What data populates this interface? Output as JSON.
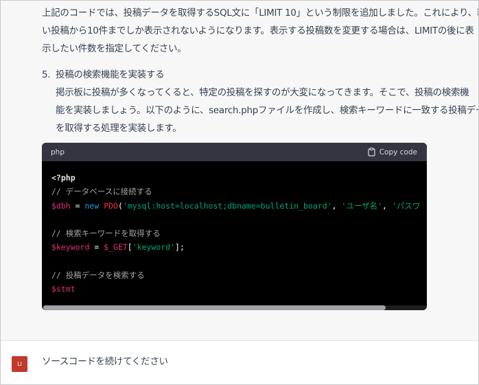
{
  "message": {
    "paragraph_lines": [
      "上記のコードでは、投稿データを取得するSQL文に「LIMIT 10」という制限を追加しました。これにより、新し",
      "い投稿から10件までしか表示されないようになります。表示する投稿数を変更する場合は、LIMITの後に表",
      "示したい件数を指定してください。"
    ],
    "list_item": {
      "number": "5.",
      "title": "投稿の検索機能を実装する",
      "body_lines": [
        "掲示板に投稿が多くなってくると、特定の投稿を探すのが大変になってきます。そこで、投稿の検索機",
        "能を実装しましょう。以下のように、search.phpファイルを作成し、検索キーワードに一致する投稿データ",
        "を取得する処理を実装します。"
      ]
    }
  },
  "code_block": {
    "language": "php",
    "copy_label": "Copy code",
    "lines": [
      [
        {
          "t": "<?php",
          "c": "c-bold"
        }
      ],
      [
        {
          "t": "// データベースに接続する",
          "c": "c-comment"
        }
      ],
      [
        {
          "t": "$dbh",
          "c": "c-var"
        },
        {
          "t": " = ",
          "c": "c-plain"
        },
        {
          "t": "new",
          "c": "c-kw"
        },
        {
          "t": " ",
          "c": "c-plain"
        },
        {
          "t": "PDO",
          "c": "c-cls"
        },
        {
          "t": "(",
          "c": "c-plain"
        },
        {
          "t": "'mysql:host=localhost;dbname=bulletin_board'",
          "c": "c-str"
        },
        {
          "t": ", ",
          "c": "c-plain"
        },
        {
          "t": "'ユーザ名'",
          "c": "c-str"
        },
        {
          "t": ", ",
          "c": "c-plain"
        },
        {
          "t": "'パスワ",
          "c": "c-str"
        }
      ],
      [],
      [
        {
          "t": "// 検索キーワードを取得する",
          "c": "c-comment"
        }
      ],
      [
        {
          "t": "$keyword",
          "c": "c-var"
        },
        {
          "t": " = ",
          "c": "c-plain"
        },
        {
          "t": "$_GET",
          "c": "c-var"
        },
        {
          "t": "[",
          "c": "c-plain"
        },
        {
          "t": "'keyword'",
          "c": "c-str"
        },
        {
          "t": "];",
          "c": "c-plain"
        }
      ],
      [],
      [
        {
          "t": "// 投稿データを検索する",
          "c": "c-comment"
        }
      ],
      [
        {
          "t": "$stmt",
          "c": "c-var"
        }
      ]
    ]
  },
  "user_message": {
    "avatar_text": "LI",
    "avatar_color": "#c0392b",
    "text": "ソースコードを続けてください"
  }
}
